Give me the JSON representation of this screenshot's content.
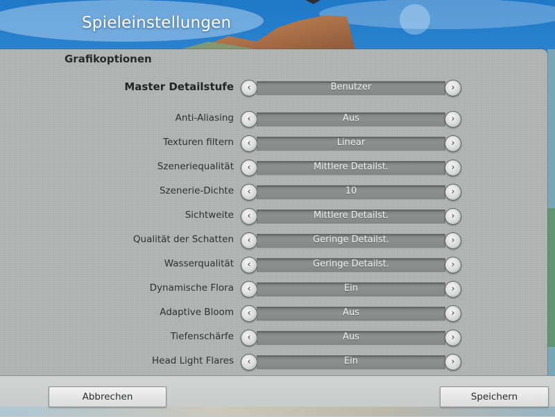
{
  "header": {
    "title": "Spieleinstellungen"
  },
  "section": {
    "title": "Grafikoptionen"
  },
  "settings": [
    {
      "label": "Master Detailstufe",
      "value": "Benutzer"
    },
    {
      "label": "Anti-Aliasing",
      "value": "Aus"
    },
    {
      "label": "Texturen filtern",
      "value": "Linear"
    },
    {
      "label": "Szeneriequalität",
      "value": "Mittlere Detailst."
    },
    {
      "label": "Szenerie-Dichte",
      "value": "10"
    },
    {
      "label": "Sichtweite",
      "value": "Mittlere Detailst."
    },
    {
      "label": "Qualität der Schatten",
      "value": "Geringe Detailst."
    },
    {
      "label": "Wasserqualität",
      "value": "Geringe Detailst."
    },
    {
      "label": "Dynamische Flora",
      "value": "Ein"
    },
    {
      "label": "Adaptive Bloom",
      "value": "Aus"
    },
    {
      "label": "Tiefenschärfe",
      "value": "Aus"
    },
    {
      "label": "Head Light Flares",
      "value": "Ein"
    }
  ],
  "footer": {
    "cancel_label": "Abbrechen",
    "save_label": "Speichern"
  },
  "icons": {
    "prev": "chevron-left-icon",
    "next": "chevron-right-icon"
  }
}
